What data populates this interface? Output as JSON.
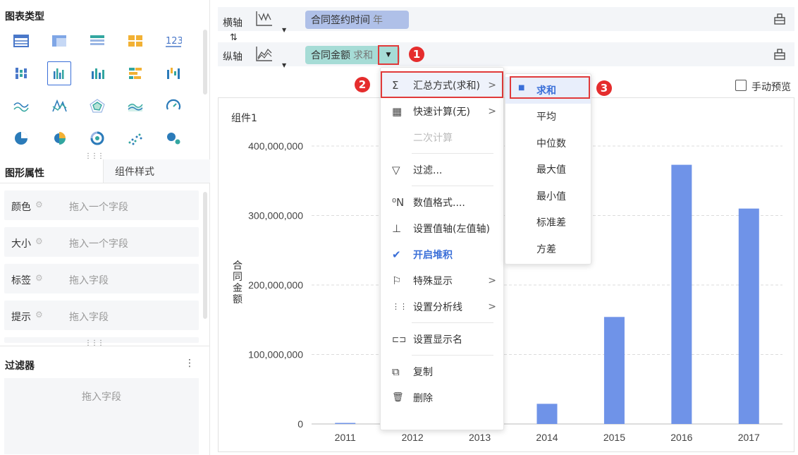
{
  "left_panel": {
    "chart_types_title": "图表类型",
    "chart_types": [
      "table-icon",
      "cross-table-icon",
      "detail-table-icon",
      "kpi-card-icon",
      "number-icon",
      "grouped-table-icon",
      "column-chart-icon",
      "bar-chart-icon",
      "stacked-bar-icon",
      "waterfall-icon",
      "line-chart-icon",
      "radar-line-icon",
      "radar-chart-icon",
      "area-chart-icon",
      "gauge-icon",
      "pie-chart-icon",
      "rose-chart-icon",
      "ring-chart-icon",
      "scatter-chart-icon",
      "bubble-chart-icon"
    ],
    "tab_active": "图形属性",
    "tab_other": "组件样式",
    "props": [
      {
        "name": "颜色",
        "value": "拖入一个字段"
      },
      {
        "name": "大小",
        "value": "拖入一个字段"
      },
      {
        "name": "标签",
        "value": "拖入字段"
      },
      {
        "name": "提示",
        "value": "拖入字段"
      }
    ],
    "filter_title": "过滤器",
    "filter_placeholder": "拖入字段"
  },
  "axes": {
    "x_label": "横轴",
    "y_label": "纵轴",
    "swap_icon": "swap-vertical-icon",
    "x_field": "合同签约时间",
    "x_field_sub": "年",
    "y_field": "合同金额",
    "y_field_sub": "求和"
  },
  "preview_label": "手动预览",
  "badges": [
    "1",
    "2",
    "3"
  ],
  "menu": {
    "items": [
      {
        "icon": "Σ",
        "label": "汇总方式(求和)",
        "submenu": true
      },
      {
        "icon": "▦",
        "label": "快速计算(无)",
        "submenu": true
      },
      {
        "icon": "",
        "label": "二次计算",
        "disabled": true
      },
      {
        "icon": "▽",
        "label": "过滤..."
      },
      {
        "icon": "⁰N",
        "label": "数值格式...."
      },
      {
        "icon": "⊥",
        "label": "设置值轴(左值轴)"
      },
      {
        "icon": "✔",
        "label": "开启堆积",
        "active": true
      },
      {
        "icon": "⚐",
        "label": "特殊显示",
        "submenu": true
      },
      {
        "icon": "⋮⋮",
        "label": "设置分析线",
        "submenu": true
      },
      {
        "icon": "⊏⊐",
        "label": "设置显示名"
      },
      {
        "icon": "⧉",
        "label": "复制"
      },
      {
        "icon": "🗑",
        "label": "删除"
      }
    ]
  },
  "submenu": {
    "items": [
      "求和",
      "平均",
      "中位数",
      "最大值",
      "最小值",
      "标准差",
      "方差"
    ],
    "selected": "求和"
  },
  "chart_data": {
    "type": "bar",
    "title": "组件1",
    "ylabel": "合同金额",
    "categories": [
      "2011",
      "2012",
      "2013",
      "2014",
      "2015",
      "2016",
      "2017"
    ],
    "values": [
      1500000,
      0,
      0,
      29000000,
      154000000,
      373000000,
      310000000
    ],
    "ylim": [
      0,
      400000000
    ],
    "yticks": [
      "0",
      "100,000,000",
      "200,000,000",
      "300,000,000",
      "400,000,000"
    ],
    "color": "#6f93e8",
    "grid": true
  }
}
